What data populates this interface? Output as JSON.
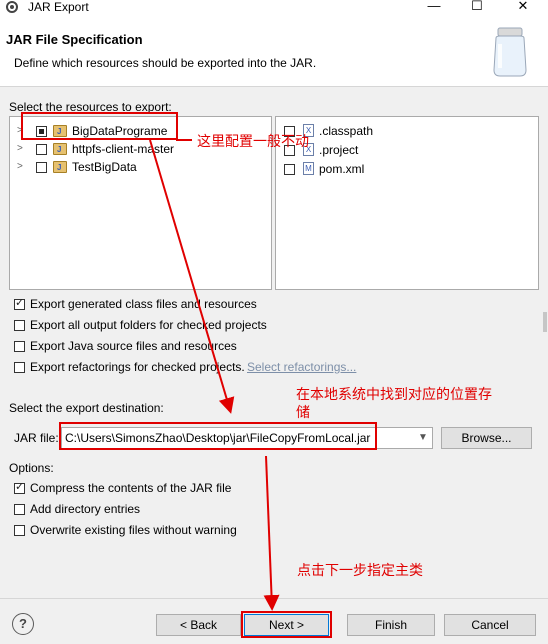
{
  "window": {
    "title": "JAR Export",
    "minimize": "—",
    "maximize": "☐",
    "close": "✕"
  },
  "header": {
    "title": "JAR File Specification",
    "description": "Define which resources should be exported into the JAR."
  },
  "resources": {
    "label": "Select the resources to export:",
    "projects": [
      {
        "name": "BigDataPrograme",
        "state": "partial"
      },
      {
        "name": "httpfs-client-master",
        "state": "unchecked"
      },
      {
        "name": "TestBigData",
        "state": "unchecked"
      }
    ],
    "files": [
      {
        "name": ".classpath",
        "icon": "X"
      },
      {
        "name": ".project",
        "icon": "X"
      },
      {
        "name": "pom.xml",
        "icon": "M"
      }
    ]
  },
  "export_options": [
    {
      "label": "Export generated class files and resources",
      "checked": true
    },
    {
      "label": "Export all output folders for checked projects",
      "checked": false
    },
    {
      "label": "Export Java source files and resources",
      "checked": false
    },
    {
      "label": "Export refactorings for checked projects.",
      "checked": false
    }
  ],
  "select_refactorings": "Select refactorings...",
  "destination": {
    "label": "Select the export destination:",
    "jar_label": "JAR file:",
    "jar_path": "C:\\Users\\SimonsZhao\\Desktop\\jar\\FileCopyFromLocal.jar",
    "browse": "Browse..."
  },
  "options": {
    "label": "Options:",
    "items": [
      {
        "label": "Compress the contents of the JAR file",
        "checked": true
      },
      {
        "label": "Add directory entries",
        "checked": false
      },
      {
        "label": "Overwrite existing files without warning",
        "checked": false
      }
    ]
  },
  "buttons": {
    "help": "?",
    "back": "< Back",
    "next": "Next >",
    "finish": "Finish",
    "cancel": "Cancel"
  },
  "annotations": {
    "note1": "这里配置一般不动",
    "note2_line1": "在本地系统中找到对应的位置存",
    "note2_line2": "储",
    "note3": "点击下一步指定主类",
    "color": "#e00000"
  }
}
